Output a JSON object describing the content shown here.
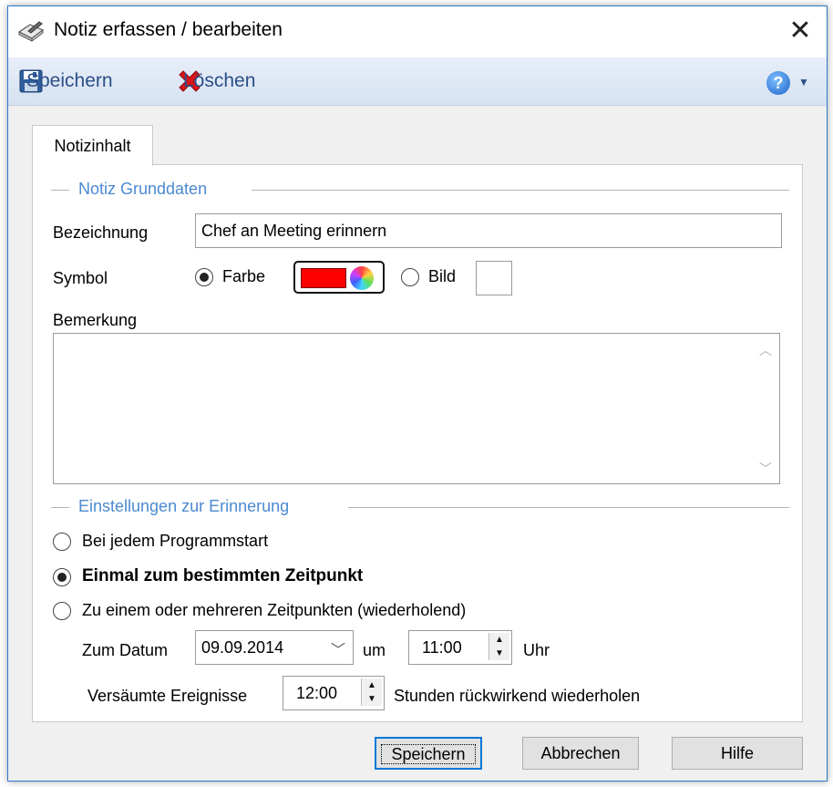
{
  "window": {
    "title": "Notiz erfassen / bearbeiten"
  },
  "toolbar": {
    "save_label": "Speichern",
    "delete_label": "Löschen"
  },
  "icons": {
    "title_icon": "notebook-pen-icon",
    "save_icon": "floppy-disk-icon",
    "delete_icon": "red-x-icon",
    "help_icon": "question-mark-icon"
  },
  "tab": {
    "label": "Notizinhalt"
  },
  "grunddaten": {
    "group_title": "Notiz Grunddaten",
    "bezeichnung_label": "Bezeichnung",
    "bezeichnung_value": "Chef an Meeting erinnern",
    "symbol_label": "Symbol",
    "farbe_label": "Farbe",
    "bild_label": "Bild",
    "selected_color": "#ff0000",
    "bemerkung_label": "Bemerkung",
    "bemerkung_value": ""
  },
  "erinnerung": {
    "group_title": "Einstellungen zur Erinnerung",
    "option1": "Bei jedem Programmstart",
    "option2": "Einmal zum bestimmten Zeitpunkt",
    "option3": "Zu einem oder mehreren Zeitpunkten (wiederholend)",
    "selected_option": 2,
    "datum_label": "Zum Datum",
    "datum_value": "09.09.2014",
    "um_label": "um",
    "time_value": "11:00",
    "uhr_label": "Uhr",
    "versaeumte_label": "Versäumte Ereignisse",
    "versaeumte_value": "12:00",
    "stunden_label": "Stunden rückwirkend wiederholen"
  },
  "buttons": {
    "save": "Speichern",
    "cancel": "Abbrechen",
    "help": "Hilfe"
  },
  "colors": {
    "accent": "#4b8ad0",
    "toolbar_text": "#2b4f88",
    "window_border": "#2b78c9"
  }
}
